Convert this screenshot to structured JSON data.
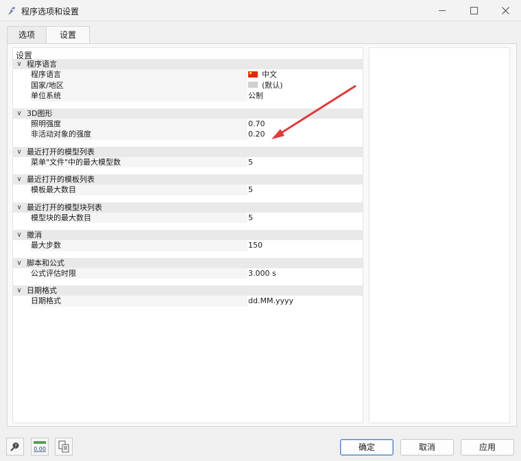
{
  "window": {
    "title": "程序选项和设置"
  },
  "tabs": [
    {
      "label": "选项"
    },
    {
      "label": "设置"
    }
  ],
  "panel": {
    "heading": "设置"
  },
  "groups": [
    {
      "label": "程序语言",
      "rows": [
        {
          "label": "程序语言",
          "value": "中文"
        },
        {
          "label": "国家/地区",
          "value": "(默认)"
        },
        {
          "label": "单位系统",
          "value": "公制"
        }
      ]
    },
    {
      "label": "3D图形",
      "rows": [
        {
          "label": "照明强度",
          "value": "0.70"
        },
        {
          "label": "非活动对象的强度",
          "value": "0.20"
        }
      ]
    },
    {
      "label": "最近打开的模型列表",
      "rows": [
        {
          "label": "菜单\"文件\"中的最大模型数",
          "value": "5"
        }
      ]
    },
    {
      "label": "最近打开的模板列表",
      "rows": [
        {
          "label": "模板最大数目",
          "value": "5"
        }
      ]
    },
    {
      "label": "最近打开的模型块列表",
      "rows": [
        {
          "label": "模型块的最大数目",
          "value": "5"
        }
      ]
    },
    {
      "label": "撤消",
      "rows": [
        {
          "label": "最大步数",
          "value": "150"
        }
      ]
    },
    {
      "label": "脚本和公式",
      "rows": [
        {
          "label": "公式评估时限",
          "value": "3.000 s"
        }
      ]
    },
    {
      "label": "日期格式",
      "rows": [
        {
          "label": "日期格式",
          "value": "dd.MM.yyyy"
        }
      ]
    }
  ],
  "toolbar": {
    "units_icon_text": "0.00"
  },
  "buttons": {
    "ok": "确定",
    "cancel": "取消",
    "apply": "应用"
  },
  "colors": {
    "annotation_arrow": "#e03a3a",
    "ok_border": "#4f7fc4"
  }
}
